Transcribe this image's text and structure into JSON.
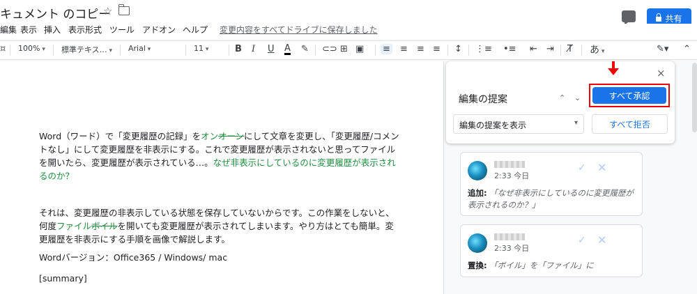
{
  "header": {
    "doc_title": "キュメント のコピー",
    "share_label": "共有"
  },
  "menu": {
    "items": [
      "編集",
      "表示",
      "挿入",
      "表示形式",
      "ツール",
      "アドオン",
      "ヘルプ"
    ],
    "save_status": "変更内容をすべてドライブに保存しました"
  },
  "toolbar": {
    "zoom": "100%",
    "style": "標準テキス…",
    "font": "Arial",
    "size": "11",
    "input_mode": "あ"
  },
  "document": {
    "p1": {
      "a": "Word（ワード）で「変更履歴の記録」を",
      "ins1": "オン",
      "del1": "オーン",
      "b": "にして文章を変更し、「変更履歴/コメントなし」にして変更履歴を非表示にする。これで変更履歴が表示されないと思ってファイルを開いたら、変更履歴が表示されている…。",
      "ins2": "なぜ非表示にしているのに変更履歴が表示されるのか？"
    },
    "p2": {
      "a": "それは、変更履歴の非表示している状態を保存していないからです。この作業をしないと、何度",
      "ins": "ファイル",
      "del": "ボイル",
      "b": "を開いても変更履歴が表示されてしまいます。やり方はとても簡単。変更履歴を非表示にする手順を画像で解説します。"
    },
    "p3": "Wordバージョン：Office365 / Windows/ mac",
    "p4": "[summary]"
  },
  "suggestions_panel": {
    "title": "編集の提案",
    "accept_all": "すべて承認",
    "reject_all": "すべて拒否",
    "view_select": "編集の提案を表示",
    "close": "×"
  },
  "cards": [
    {
      "time": "2:33 今日",
      "action": "追加:",
      "text": "「なぜ非表示にしているのに変更履歴が表示されるのか？」"
    },
    {
      "time": "2:33 今日",
      "action": "置換:",
      "text": "「ボイル」を「ファイル」に"
    }
  ],
  "colors": {
    "accent": "#1a73e8",
    "highlight": "#e00000",
    "suggestion": "#1e8e3e"
  }
}
